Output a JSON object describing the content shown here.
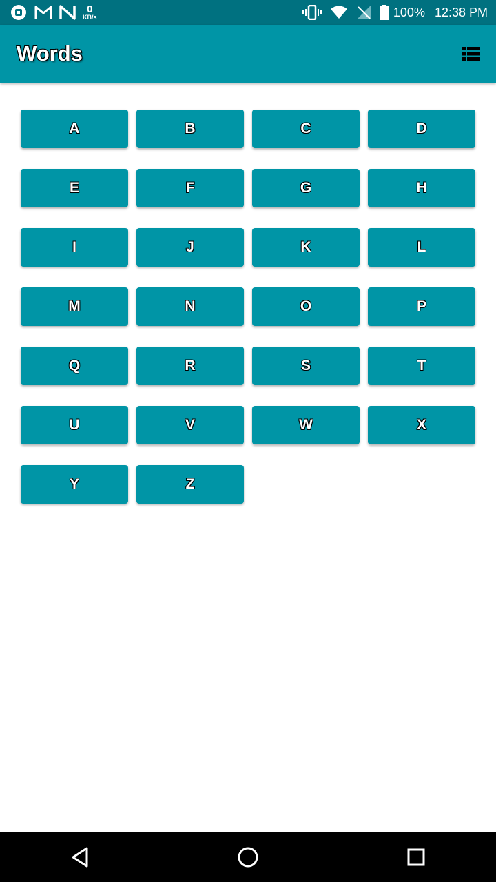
{
  "status_bar": {
    "left_icons": [
      "vpn-app-icon",
      "gmail-icon",
      "n-app-icon"
    ],
    "netspeed_value": "0",
    "netspeed_unit": "KB/s",
    "right_icons": [
      "vibrate-icon",
      "wifi-icon",
      "no-sim-icon",
      "battery-icon"
    ],
    "battery_percent": "100%",
    "time": "12:38 PM"
  },
  "app_bar": {
    "title": "Words",
    "action_icon": "view-list-icon"
  },
  "letters": [
    "A",
    "B",
    "C",
    "D",
    "E",
    "F",
    "G",
    "H",
    "I",
    "J",
    "K",
    "L",
    "M",
    "N",
    "O",
    "P",
    "Q",
    "R",
    "S",
    "T",
    "U",
    "V",
    "W",
    "X",
    "Y",
    "Z"
  ],
  "nav_bar": {
    "icons": [
      "back-icon",
      "home-icon",
      "recents-icon"
    ]
  },
  "colors": {
    "status_bar": "#007180",
    "primary": "#0095a6",
    "background": "#ffffff",
    "nav_bar": "#000000"
  }
}
